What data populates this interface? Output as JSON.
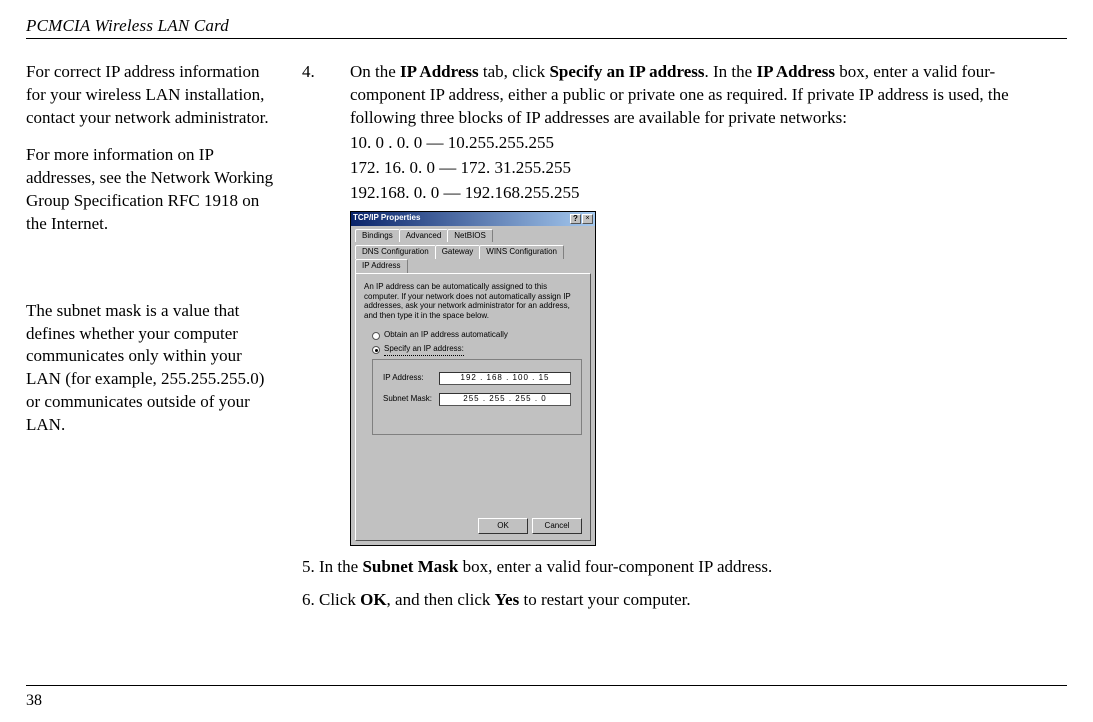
{
  "header": {
    "title": "PCMCIA Wireless LAN Card"
  },
  "sidebar": {
    "p1": "For correct IP address information for your wireless LAN installation, contact your network administrator.",
    "p2": "For more information on IP addresses, see the Network Working Group Specification RFC 1918 on the Internet.",
    "p3": "The subnet mask is a value that defines whether your computer communicates only within your LAN (for example, 255.255.255.0) or communicates outside of your LAN."
  },
  "main": {
    "step4": {
      "num": "4.",
      "text_parts": {
        "a": "On the ",
        "b": "IP Address",
        "c": " tab, click ",
        "d": "Specify an IP address",
        "e": ". In the ",
        "f": "IP Address",
        "g": " box, enter a valid four-component IP address, either a public or private one as required. If private IP address is used, the following three blocks of IP addresses are available for private networks:"
      },
      "range1": "10. 0 . 0. 0 — 10.255.255.255",
      "range2": "172. 16. 0. 0 — 172. 31.255.255",
      "range3": "192.168. 0. 0 — 192.168.255.255"
    },
    "step5": {
      "a": "5. In the ",
      "b": "Subnet Mask",
      "c": " box, enter a valid four-component IP address."
    },
    "step6": {
      "a": "6. Click ",
      "b": "OK",
      "c": ", and then click ",
      "d": "Yes",
      "e": " to restart your computer."
    }
  },
  "dialog": {
    "title": "TCP/IP Properties",
    "help_icon": "?",
    "close_icon": "×",
    "tabs_row1": {
      "bindings": "Bindings",
      "advanced": "Advanced",
      "netbios": "NetBIOS"
    },
    "tabs_row2": {
      "dns": "DNS Configuration",
      "gateway": "Gateway",
      "wins": "WINS Configuration",
      "ip": "IP Address"
    },
    "desc": "An IP address can be automatically assigned to this computer. If your network does not automatically assign IP addresses, ask your network administrator for an address, and then type it in the space below.",
    "radio_auto": "Obtain an IP address automatically",
    "radio_specify": "Specify an IP address:",
    "label_ip": "IP Address:",
    "label_mask": "Subnet Mask:",
    "value_ip": "192 . 168 . 100 .  15",
    "value_mask": "255 . 255 . 255 .   0",
    "ok": "OK",
    "cancel": "Cancel"
  },
  "page_number": "38"
}
